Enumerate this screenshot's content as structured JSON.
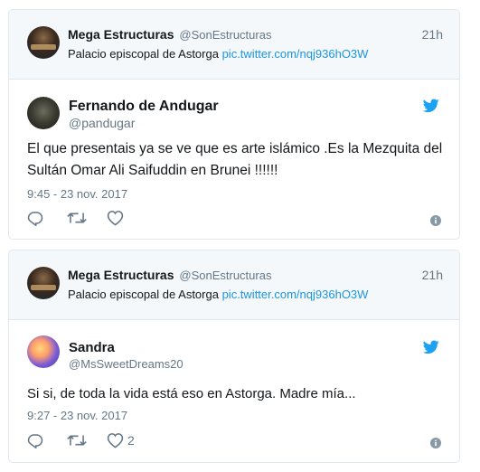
{
  "tweets": [
    {
      "quoted": {
        "name": "Mega Estructuras",
        "handle": "@SonEstructuras",
        "time": "21h",
        "text": "Palacio episcopal de Astorga",
        "link": "pic.twitter.com/nqj936hO3W"
      },
      "author": {
        "name": "Fernando de Andugar",
        "handle": "@pandugar"
      },
      "text": "El que presentais ya se ve que es arte islámico .Es la Mezquita del Sultán Omar Ali Saifuddin en Brunei !!!!!!",
      "date": "9:45 - 23 nov. 2017",
      "likes": ""
    },
    {
      "quoted": {
        "name": "Mega Estructuras",
        "handle": "@SonEstructuras",
        "time": "21h",
        "text": "Palacio episcopal de Astorga",
        "link": "pic.twitter.com/nqj936hO3W"
      },
      "author": {
        "name": "Sandra",
        "handle": "@MsSweetDreams20"
      },
      "text": "Si si, de toda la vida está eso en Astorga. Madre mía...",
      "date": "9:27 - 23 nov. 2017",
      "likes": "2"
    }
  ],
  "colors": {
    "link": "#1b95e0",
    "muted": "#657786",
    "twitter_blue": "#1da1f2"
  },
  "icons": [
    "quoted-avatar",
    "author-avatar",
    "twitter-bird-icon",
    "reply-icon",
    "retweet-icon",
    "like-icon",
    "info-icon"
  ]
}
